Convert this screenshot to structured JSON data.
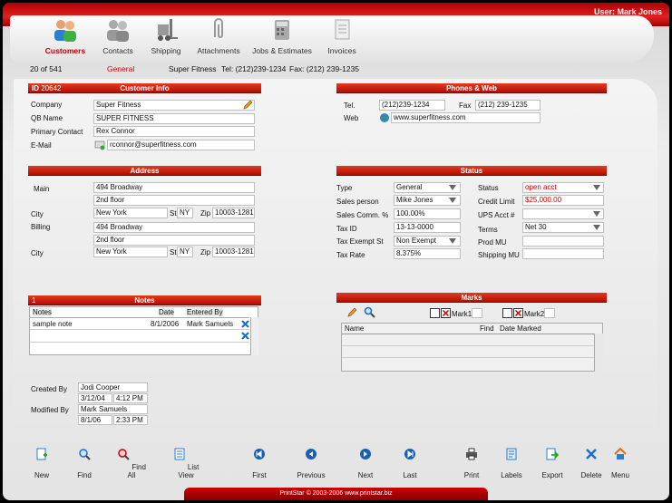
{
  "header": {
    "user_label": "User: Mark Jones"
  },
  "nav": {
    "tabs": [
      {
        "label": "Customers",
        "icon": "customers-icon",
        "active": true
      },
      {
        "label": "Contacts",
        "icon": "contacts-icon",
        "active": false
      },
      {
        "label": "Shipping",
        "icon": "forklift-icon",
        "active": false
      },
      {
        "label": "Attachments",
        "icon": "paperclip-icon",
        "active": false
      },
      {
        "label": "Jobs & Estimates",
        "icon": "calculator-icon",
        "active": false
      },
      {
        "label": "Invoices",
        "icon": "invoice-icon",
        "active": false
      }
    ],
    "record_count": "20 of 541",
    "sub_label": "General",
    "summary_name": "Super Fitness",
    "summary_tel": "Tel: (212)239-1234",
    "summary_fax": "Fax: (212) 239-1235"
  },
  "customer_info": {
    "id_label": "ID",
    "id_value": "20642",
    "title": "Customer Info",
    "company_label": "Company",
    "company": "Super Fitness",
    "qb_label": "QB Name",
    "qb": "SUPER FITNESS",
    "contact_label": "Primary Contact",
    "contact": "Rex Connor",
    "email_label": "E-Mail",
    "email": "rconnor@superfitness.com"
  },
  "phones": {
    "title": "Phones & Web",
    "tel_label": "Tel.",
    "tel": "(212)239-1234",
    "fax_label": "Fax",
    "fax": "(212) 239-1235",
    "web_label": "Web",
    "web": "www.superfitness.com"
  },
  "address": {
    "title": "Address",
    "main_label": "Main",
    "main1": "494 Broadway",
    "main2": "2nd floor",
    "city_label": "City",
    "city": "New York",
    "st_label": "St",
    "st": "NY",
    "zip_label": "Zip",
    "zip": "10003-1281",
    "billing_label": "Billing",
    "bill1": "494 Broadway",
    "bill2": "2nd floor",
    "bcity_label": "City",
    "bcity": "New York",
    "bst_label": "St",
    "bst": "NY",
    "bzip_label": "Zip",
    "bzip": "10003-1281"
  },
  "status": {
    "title": "Status",
    "type_label": "Type",
    "type": "General",
    "sales_label": "Sales person",
    "sales": "Mike Jones",
    "comm_label": "Sales Comm. %",
    "comm": "100.00%",
    "taxid_label": "Tax ID",
    "taxid": "13-13-0000",
    "taxex_label": "Tax Exempt St",
    "taxex": "Non Exempt",
    "taxrate_label": "Tax Rate",
    "taxrate": "8.375%",
    "status_label": "Status",
    "status": "open acct",
    "credit_label": "Credit Limit",
    "credit": "$25,000.00",
    "ups_label": "UPS Acct #",
    "ups": "",
    "terms_label": "Terms",
    "terms": "Net 30",
    "prod_label": "Prod MU",
    "prod": "",
    "ship_label": "Shipping MU",
    "ship": ""
  },
  "notes": {
    "count": "1",
    "title": "Notes",
    "col_notes": "Notes",
    "col_date": "Date",
    "col_by": "Entered By",
    "rows": [
      {
        "note": "sample note",
        "date": "8/1/2006",
        "by": "Mark Samuels"
      }
    ]
  },
  "marks": {
    "title": "Marks",
    "mark1": "Mark1",
    "mark2": "Mark2",
    "col_name": "Name",
    "col_find": "Find",
    "col_date": "Date Marked"
  },
  "audit": {
    "created_label": "Created By",
    "created_by": "Jodi Cooper",
    "created_date": "3/12/04",
    "created_time": "4:12 PM",
    "modified_label": "Modified By",
    "modified_by": "Mark Samuels",
    "modified_date": "8/1/06",
    "modified_time": "2:33 PM"
  },
  "toolbar": {
    "new": "New",
    "find": "Find",
    "findall": "Find All",
    "listview": "List View",
    "first": "First",
    "previous": "Previous",
    "next": "Next",
    "last": "Last",
    "print": "Print",
    "labels": "Labels",
    "export": "Export",
    "delete": "Delete",
    "menu": "Menu"
  },
  "footer": {
    "text": "PrintStar © 2003-2006 www.printstar.biz"
  },
  "colors": {
    "accent": "#c00000",
    "header_band": "#d02010",
    "link_blue": "#1060c0"
  }
}
